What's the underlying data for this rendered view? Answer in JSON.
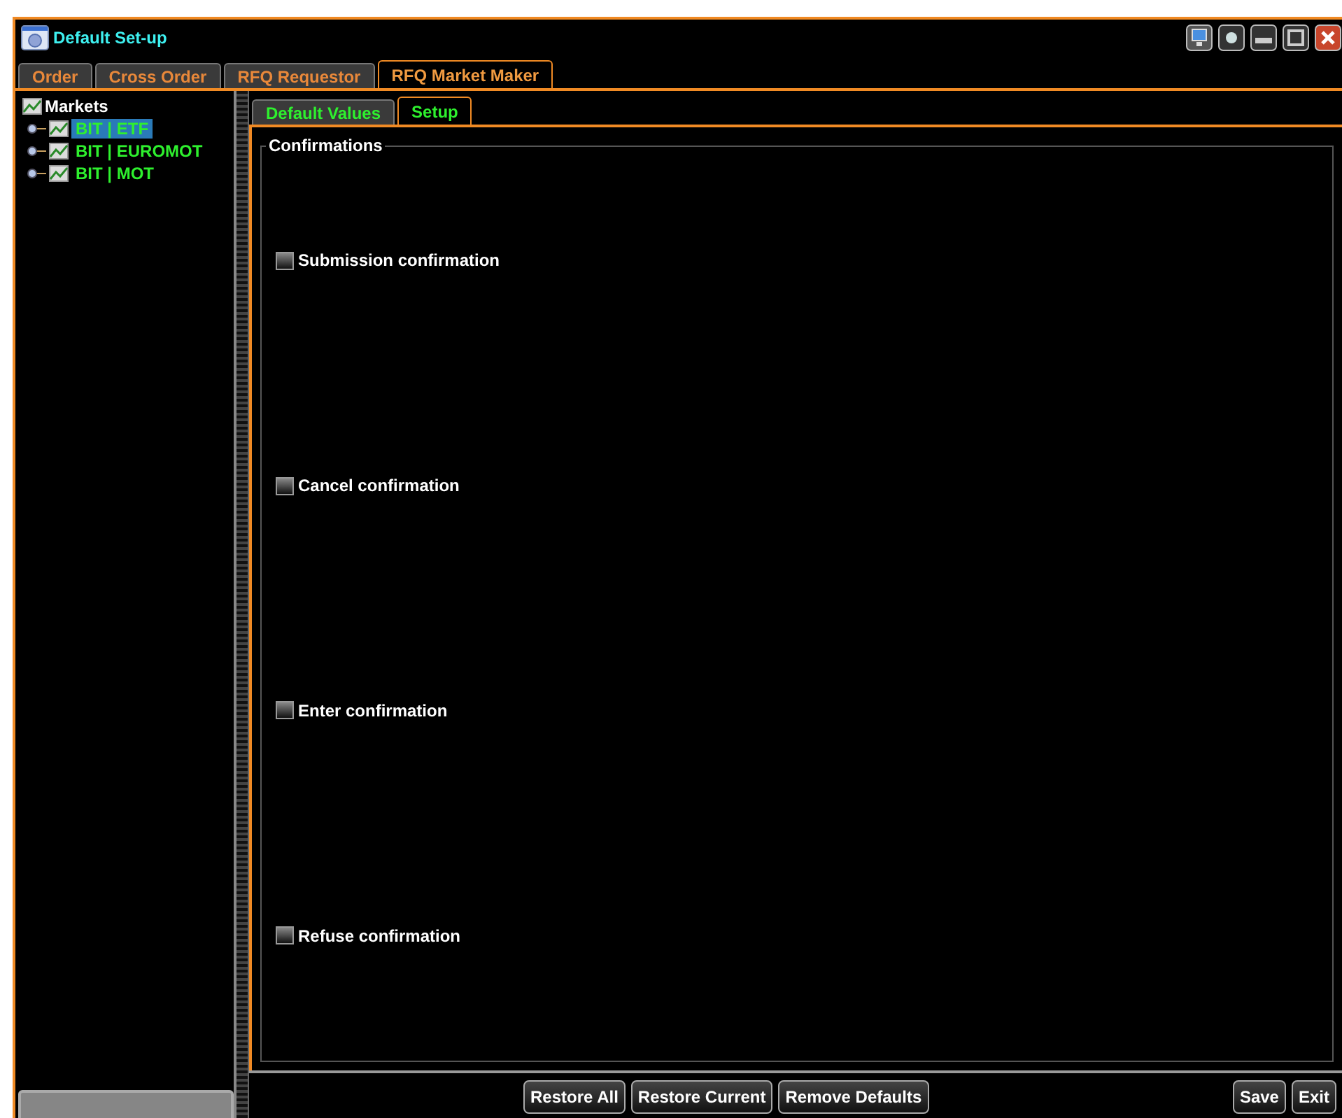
{
  "window": {
    "title": "Default Set-up"
  },
  "tabs": [
    {
      "label": "Order",
      "selected": false
    },
    {
      "label": "Cross Order",
      "selected": false
    },
    {
      "label": "RFQ Requestor",
      "selected": false
    },
    {
      "label": "RFQ Market Maker",
      "selected": true
    }
  ],
  "tree": {
    "label": "Markets",
    "children": [
      {
        "label": "BIT | ETF",
        "selected": true,
        "expanded": false
      },
      {
        "label": "BIT | EUROMOT",
        "selected": false,
        "expanded": false
      },
      {
        "label": "BIT | MOT",
        "selected": false,
        "expanded": false
      }
    ]
  },
  "sub_tabs": [
    {
      "label": "Default Values",
      "selected": false
    },
    {
      "label": "Setup",
      "selected": true
    }
  ],
  "group": {
    "title": "Confirmations",
    "options": [
      {
        "label": "Submission confirmation",
        "checked": false
      },
      {
        "label": "Cancel confirmation",
        "checked": false
      },
      {
        "label": "Enter confirmation",
        "checked": false
      },
      {
        "label": "Refuse confirmation",
        "checked": false
      }
    ]
  },
  "left_buttons": [
    "Restore All",
    "Restore Current",
    "Remove Defaults"
  ],
  "right_buttons": [
    "Save",
    "Exit"
  ]
}
